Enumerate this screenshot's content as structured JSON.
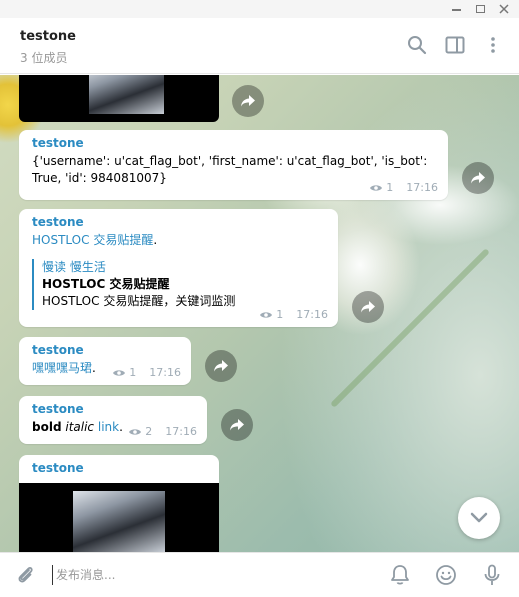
{
  "window": {
    "min_glyph": "—",
    "max_glyph": "□",
    "close_glyph": "✕"
  },
  "header": {
    "title": "testone",
    "subtitle": "3 位成员"
  },
  "messages": [
    {
      "sender": "testone",
      "text": "{'username': u'cat_flag_bot', 'first_name': u'cat_flag_bot', 'is_bot': True, 'id': 984081007}",
      "views": "1",
      "time": "17:16"
    },
    {
      "sender": "testone",
      "link_text": "HOSTLOC 交易贴提醒",
      "trail": ".",
      "quote_author": "慢读 慢生活",
      "quote_title": "HOSTLOC 交易贴提醒",
      "quote_desc": "HOSTLOC 交易贴提醒，关键词监测",
      "views": "1",
      "time": "17:16"
    },
    {
      "sender": "testone",
      "link_text": "嘿嘿嘿马珺",
      "trail": ".",
      "views": "1",
      "time": "17:16"
    },
    {
      "sender": "testone",
      "bold": "bold",
      "italic": "italic",
      "link": "link",
      "trail": ".",
      "views": "2",
      "time": "17:16"
    },
    {
      "sender": "testone"
    }
  ],
  "composer": {
    "placeholder": "发布消息..."
  },
  "colors": {
    "accent": "#2b8bc2",
    "meta": "#a0acb6",
    "icon": "#8f9aa3"
  },
  "icons": [
    "minimize-icon",
    "maximize-icon",
    "close-icon",
    "search-icon",
    "sidebar-toggle-icon",
    "more-vertical-icon",
    "share-icon",
    "eye-icon",
    "chevron-down-icon",
    "paperclip-icon",
    "bell-icon",
    "emoji-icon",
    "microphone-icon"
  ]
}
